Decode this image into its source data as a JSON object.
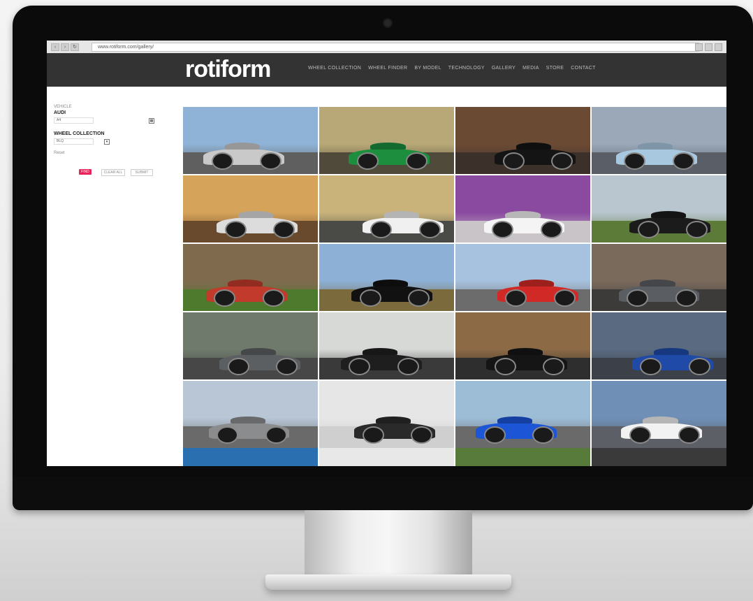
{
  "browser": {
    "url": "www.rotiform.com/gallery/",
    "nav_back": "‹",
    "nav_forward": "›",
    "nav_reload": "↻"
  },
  "site": {
    "logo": "rotiform",
    "menu": [
      "WHEEL COLLECTION",
      "WHEEL FINDER",
      "BY MODEL",
      "TECHNOLOGY",
      "GALLERY",
      "MEDIA",
      "STORE",
      "CONTACT"
    ]
  },
  "filters": {
    "vehicle_label": "VEHICLE",
    "vehicle_value": "AUDI",
    "vehicle_select": "A4",
    "wheel_collection_label": "WHEEL COLLECTION",
    "wheel_collection_select": "BLQ",
    "reset_label": "Reset",
    "button_primary": "FIND",
    "button_secondary": "CLEAR ALL",
    "button_tertiary": "SUBMIT",
    "accent": "#e8245a"
  },
  "gallery": {
    "tiles": [
      {
        "name": "silver-lamborghini",
        "sky": "#8fb3d6",
        "ground": "#5f5f5f",
        "car": "#c9c9c9"
      },
      {
        "name": "green-porsche",
        "sky": "#b9a877",
        "ground": "#4f4a3a",
        "car": "#1c8e3e"
      },
      {
        "name": "black-audi-tt",
        "sky": "#6b4a34",
        "ground": "#3c302a",
        "car": "#141414"
      },
      {
        "name": "blue-toyota-86",
        "sky": "#9aa8b8",
        "ground": "#5a5e66",
        "car": "#a8c8e0"
      },
      {
        "name": "white-audi-sunset",
        "sky": "#d6a35a",
        "ground": "#6a4a2c",
        "car": "#dcdcdc"
      },
      {
        "name": "white-vw-gti",
        "sky": "#c9b37a",
        "ground": "#4a4a46",
        "car": "#f0f0f0"
      },
      {
        "name": "white-audi-r8",
        "sky": "#8a4aa0",
        "ground": "#c9c4c8",
        "car": "#f4f4f4"
      },
      {
        "name": "black-bmw-field",
        "sky": "#b9c6cf",
        "ground": "#5c7a38",
        "car": "#1b1b1b"
      },
      {
        "name": "red-porsche-classic",
        "sky": "#7f6a4e",
        "ground": "#4e7a2e",
        "car": "#c23a2c"
      },
      {
        "name": "black-porsche-red-wheels",
        "sky": "#8db0d6",
        "ground": "#7a6a3c",
        "car": "#111111"
      },
      {
        "name": "red-porsche-911",
        "sky": "#a7c2de",
        "ground": "#6c6c6c",
        "car": "#d12a26"
      },
      {
        "name": "grey-vw-garage",
        "sky": "#7a6a5c",
        "ground": "#3c3b3a",
        "car": "#5a5e62"
      },
      {
        "name": "grey-subaru",
        "sky": "#6f7a6c",
        "ground": "#474747",
        "car": "#5c5f61"
      },
      {
        "name": "black-audi-lot",
        "sky": "#d7d9d7",
        "ground": "#3a3a3a",
        "car": "#1e1e1e"
      },
      {
        "name": "black-sedan-dusk",
        "sky": "#8c6a45",
        "ground": "#2e2e2e",
        "car": "#151515"
      },
      {
        "name": "blue-audi-rs",
        "sky": "#5a6a80",
        "ground": "#3c4048",
        "car": "#1f4aa8"
      },
      {
        "name": "grey-audi-hatch",
        "sky": "#b8c6d6",
        "ground": "#6a6a6a",
        "car": "#8a8c8e"
      },
      {
        "name": "black-audi-a3",
        "sky": "#e6e6e6",
        "ground": "#cfcfcf",
        "car": "#2a2a2a"
      },
      {
        "name": "blue-porsche-cayman",
        "sky": "#9dbcd6",
        "ground": "#6a6a6a",
        "car": "#1c55d6"
      },
      {
        "name": "white-vw-golf",
        "sky": "#6f8fb6",
        "ground": "#5c6066",
        "car": "#f2f2f2"
      }
    ],
    "bottom_strip": [
      "#2a6fb0",
      "#e8e8e8",
      "#587a3a",
      "#3a3a3a"
    ]
  }
}
